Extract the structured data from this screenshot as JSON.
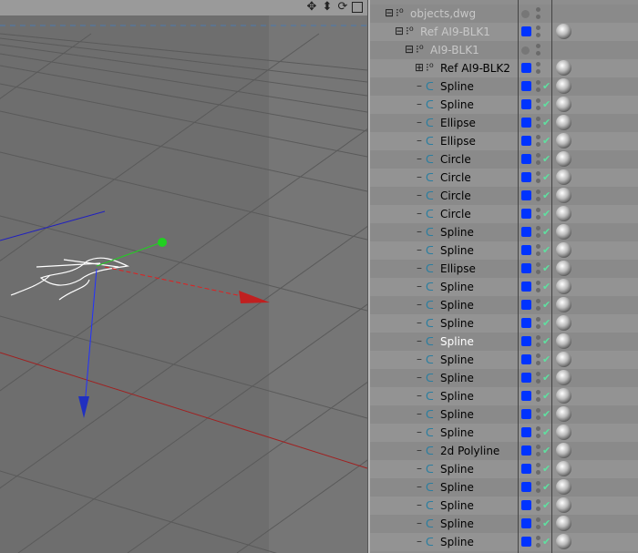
{
  "viewport": {
    "toolbar_icons": [
      "move-icon",
      "pan-down-icon",
      "rotate-icon",
      "maximize-icon"
    ]
  },
  "objects": [
    {
      "name": "objects,dwg",
      "depth": 0,
      "type": "null",
      "expand": "minus",
      "dim": true,
      "flag": "grey",
      "tag": false,
      "check": false
    },
    {
      "name": "Ref AI9-BLK1",
      "depth": 1,
      "type": "null",
      "expand": "minus",
      "dim": true,
      "flag": "blue",
      "tag": true,
      "check": false
    },
    {
      "name": "AI9-BLK1",
      "depth": 2,
      "type": "null",
      "expand": "minus",
      "dim": true,
      "flag": "grey",
      "tag": false,
      "check": false
    },
    {
      "name": "Ref AI9-BLK2",
      "depth": 3,
      "type": "null",
      "expand": "plus",
      "flag": "blue",
      "tag": true,
      "check": false
    },
    {
      "name": "Spline",
      "depth": 3,
      "type": "spline",
      "flag": "blue",
      "tag": true,
      "check": true
    },
    {
      "name": "Spline",
      "depth": 3,
      "type": "spline",
      "flag": "blue",
      "tag": true,
      "check": true
    },
    {
      "name": "Ellipse",
      "depth": 3,
      "type": "spline",
      "flag": "blue",
      "tag": true,
      "check": true
    },
    {
      "name": "Ellipse",
      "depth": 3,
      "type": "spline",
      "flag": "blue",
      "tag": true,
      "check": true
    },
    {
      "name": "Circle",
      "depth": 3,
      "type": "spline",
      "flag": "blue",
      "tag": true,
      "check": true
    },
    {
      "name": "Circle",
      "depth": 3,
      "type": "spline",
      "flag": "blue",
      "tag": true,
      "check": true
    },
    {
      "name": "Circle",
      "depth": 3,
      "type": "spline",
      "flag": "blue",
      "tag": true,
      "check": true
    },
    {
      "name": "Circle",
      "depth": 3,
      "type": "spline",
      "flag": "blue",
      "tag": true,
      "check": true
    },
    {
      "name": "Spline",
      "depth": 3,
      "type": "spline",
      "flag": "blue",
      "tag": true,
      "check": true
    },
    {
      "name": "Spline",
      "depth": 3,
      "type": "spline",
      "flag": "blue",
      "tag": true,
      "check": true
    },
    {
      "name": "Ellipse",
      "depth": 3,
      "type": "spline",
      "flag": "blue",
      "tag": true,
      "check": true
    },
    {
      "name": "Spline",
      "depth": 3,
      "type": "spline",
      "flag": "blue",
      "tag": true,
      "check": true
    },
    {
      "name": "Spline",
      "depth": 3,
      "type": "spline",
      "flag": "blue",
      "tag": true,
      "check": true
    },
    {
      "name": "Spline",
      "depth": 3,
      "type": "spline",
      "flag": "blue",
      "tag": true,
      "check": true
    },
    {
      "name": "Spline",
      "depth": 3,
      "type": "spline",
      "flag": "blue",
      "tag": true,
      "check": true,
      "selected": true
    },
    {
      "name": "Spline",
      "depth": 3,
      "type": "spline",
      "flag": "blue",
      "tag": true,
      "check": true
    },
    {
      "name": "Spline",
      "depth": 3,
      "type": "spline",
      "flag": "blue",
      "tag": true,
      "check": true
    },
    {
      "name": "Spline",
      "depth": 3,
      "type": "spline",
      "flag": "blue",
      "tag": true,
      "check": true
    },
    {
      "name": "Spline",
      "depth": 3,
      "type": "spline",
      "flag": "blue",
      "tag": true,
      "check": true
    },
    {
      "name": "Spline",
      "depth": 3,
      "type": "spline",
      "flag": "blue",
      "tag": true,
      "check": true
    },
    {
      "name": "2d Polyline",
      "depth": 3,
      "type": "spline",
      "flag": "blue",
      "tag": true,
      "check": true
    },
    {
      "name": "Spline",
      "depth": 3,
      "type": "spline",
      "flag": "blue",
      "tag": true,
      "check": true
    },
    {
      "name": "Spline",
      "depth": 3,
      "type": "spline",
      "flag": "blue",
      "tag": true,
      "check": true
    },
    {
      "name": "Spline",
      "depth": 3,
      "type": "spline",
      "flag": "blue",
      "tag": true,
      "check": true
    },
    {
      "name": "Spline",
      "depth": 3,
      "type": "spline",
      "flag": "blue",
      "tag": true,
      "check": true
    },
    {
      "name": "Spline",
      "depth": 3,
      "type": "spline",
      "flag": "blue",
      "tag": true,
      "check": true
    }
  ],
  "colors": {
    "x_axis": "#ff2020",
    "y_axis": "#20d020",
    "z_axis": "#2030ff",
    "layer_flag": "#0033ff"
  }
}
